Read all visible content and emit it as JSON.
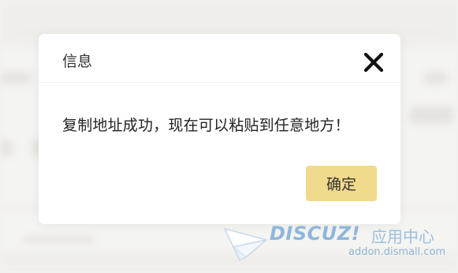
{
  "dialog": {
    "title": "信息",
    "message": "复制地址成功，现在可以粘贴到任意地方！",
    "confirm_label": "确定",
    "close_icon": "close-icon"
  },
  "watermark": {
    "brand": "DISCUZ!",
    "suffix": "应用中心",
    "url": "addon.dismall.com"
  },
  "colors": {
    "confirm_button": "#f0da8c",
    "dialog_background": "#ffffff",
    "overlay_background": "#efeeeb",
    "watermark": "#8fb6dc"
  }
}
